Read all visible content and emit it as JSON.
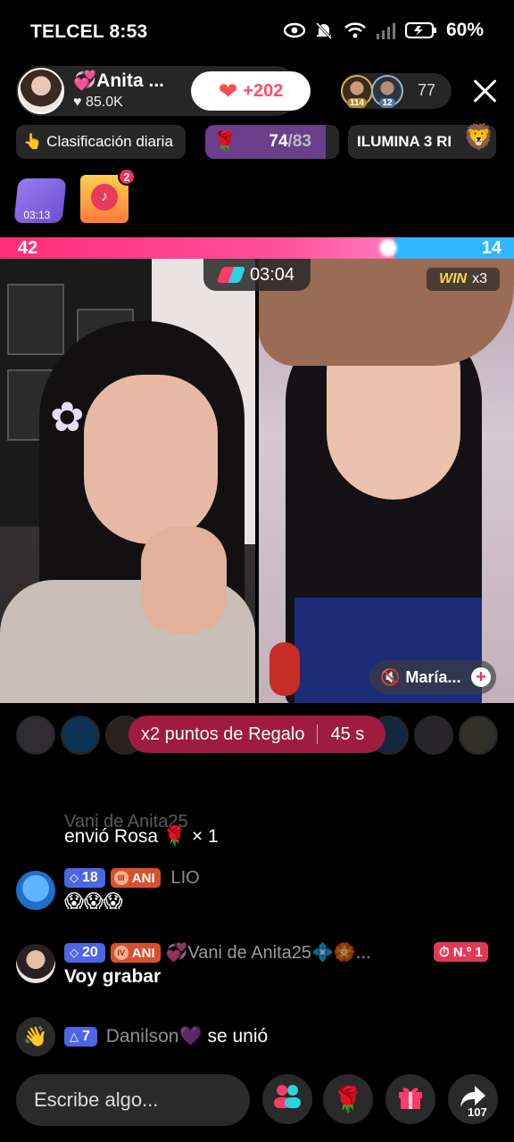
{
  "status_bar": {
    "carrier": "TELCEL",
    "time": "8:53",
    "battery": "60%"
  },
  "host": {
    "name": "💞Anita ...",
    "likes": "85.0K",
    "like_increment": "+202"
  },
  "viewers": {
    "avatar1_level": "114",
    "avatar2_level": "12",
    "count": "77"
  },
  "chips": {
    "ranking_label": "Clasificación diaria",
    "rose_progress_current": "74",
    "rose_progress_total": "/83",
    "ilumina_label": "ILUMINA 3 RI"
  },
  "widgets": {
    "timer": "03:13",
    "badge_count": "2"
  },
  "battle": {
    "left_score": "42",
    "right_score": "14",
    "left_share": 0.75,
    "timer": "03:04",
    "win_label": "WIN",
    "win_multiplier": "x3",
    "guest_name": "María..."
  },
  "bonus": {
    "label": "x2 puntos de Regalo",
    "seconds": "45 s"
  },
  "chat": {
    "ghost_line": "Vani de Anita25",
    "m1": {
      "text": "envió Rosa 🌹 × 1"
    },
    "m2": {
      "level": "18",
      "fan": "ANI",
      "name": "LIO",
      "text": "😱😱😱"
    },
    "m3": {
      "level": "20",
      "fan": "ANI",
      "name": "💞Vani de Anita25💠🏵️...",
      "rank": "N.º 1",
      "text": "Voy grabar"
    },
    "m4": {
      "level": "7",
      "name": "Danilson💜",
      "action": "se unió"
    }
  },
  "bottom_bar": {
    "input_placeholder": "Escribe algo...",
    "share_count": "107"
  },
  "colors": {
    "left_team": "#ff2d78",
    "right_team": "#2fb8ff",
    "bonus_pill": "#9f1b40",
    "level_badge": "#4d66e6"
  }
}
